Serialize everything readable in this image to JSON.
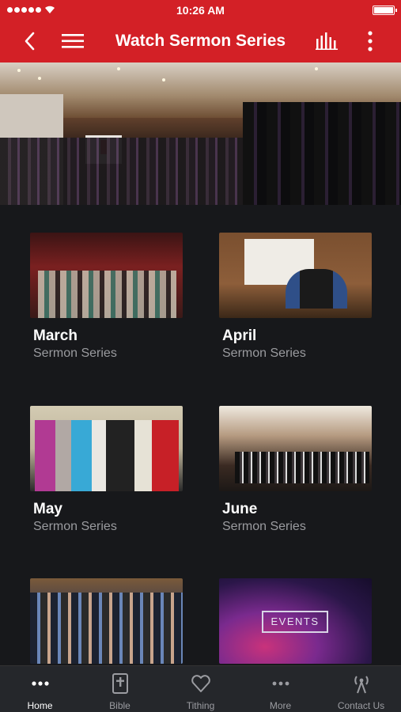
{
  "status_bar": {
    "time": "10:26 AM",
    "signal_icon": "signal-dots-icon",
    "wifi_icon": "wifi-icon",
    "battery_icon": "battery-icon"
  },
  "nav": {
    "title": "Watch Sermon Series",
    "back_icon": "chevron-left-icon",
    "menu_icon": "hamburger-menu-icon",
    "audio_icon": "equalizer-icon",
    "more_icon": "vertical-dots-icon",
    "color": "#d32026"
  },
  "grid": {
    "items": [
      {
        "title": "March",
        "subtitle": "Sermon Series"
      },
      {
        "title": "April",
        "subtitle": "Sermon Series"
      },
      {
        "title": "May",
        "subtitle": "Sermon Series"
      },
      {
        "title": "June",
        "subtitle": "Sermon Series"
      },
      {
        "title": "",
        "subtitle": ""
      },
      {
        "title": "",
        "subtitle": "",
        "overlay": "EVENTS"
      }
    ]
  },
  "tab_bar": {
    "tabs": [
      {
        "label": "Home",
        "icon": "dots-icon",
        "active": true
      },
      {
        "label": "Bible",
        "icon": "bible-icon",
        "active": false
      },
      {
        "label": "Tithing",
        "icon": "heart-icon",
        "active": false
      },
      {
        "label": "More",
        "icon": "more-dots-icon",
        "active": false
      },
      {
        "label": "Contact Us",
        "icon": "broadcast-icon",
        "active": false
      }
    ]
  }
}
